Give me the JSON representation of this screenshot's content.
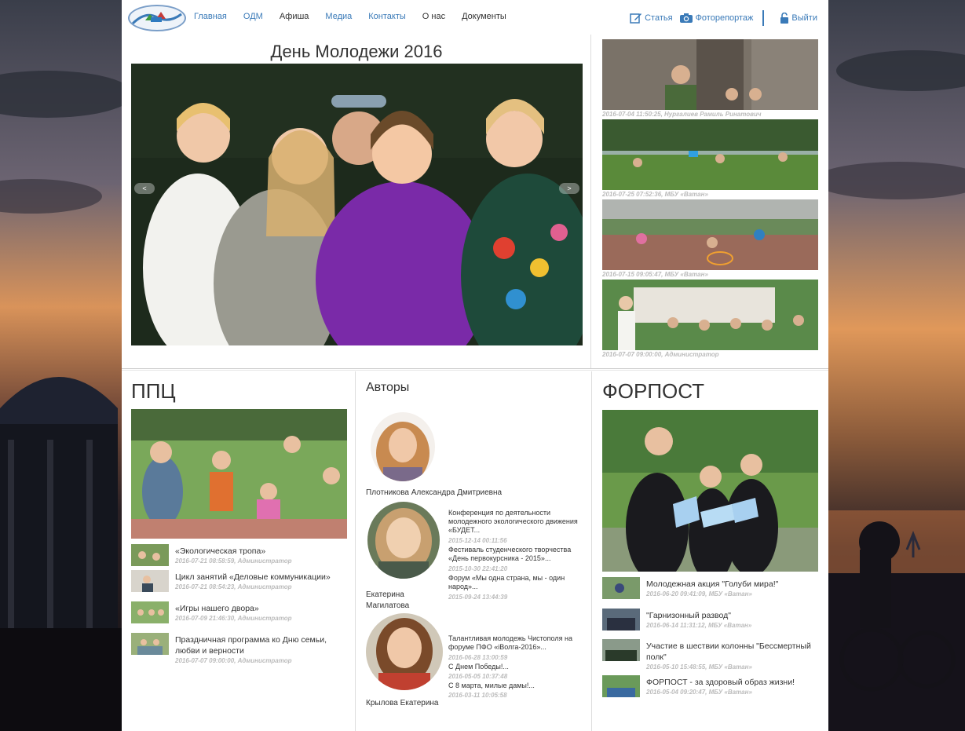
{
  "nav": {
    "items": [
      "Главная",
      "ОДМ",
      "Афиша",
      "Медиа",
      "Контакты",
      "О нас",
      "Документы"
    ],
    "article_label": "Статья",
    "photo_label": "Фоторепортаж",
    "logout_label": "Выйти"
  },
  "slider": {
    "title": "День Молодежи 2016",
    "prev": "<",
    "next": ">"
  },
  "thumbs": [
    {
      "caption": "2016-07-04 11:50:25, Нургалиев Рамиль Ринатович"
    },
    {
      "caption": "2016-07-25 07:52:36, МБУ «Ватан»"
    },
    {
      "caption": "2016-07-15 09:05:47, МБУ «Ватан»"
    },
    {
      "caption": "2016-07-07 09:00:00, Администратор"
    }
  ],
  "ppc": {
    "title": "ППЦ",
    "news": [
      {
        "title": "«Экологическая тропа»",
        "date": "2016-07-21 08:58:59, Администратор"
      },
      {
        "title": "Цикл занятий «Деловые коммуникации»",
        "date": "2016-07-21 08:54:23, Администратор"
      },
      {
        "title": "«Игры нашего двора»",
        "date": "2016-07-09 21:46:30, Администратор"
      },
      {
        "title": "Праздничная программа ко Дню семьи, любви и верности",
        "date": "2016-07-07 09:00:00, Администратор"
      }
    ]
  },
  "authors": {
    "title": "Авторы",
    "a1": {
      "name": "Плотникова Александра Дмитриевна"
    },
    "a2": {
      "name": "Екатерина Магилатова",
      "items": [
        {
          "title": "Конференция по деятельности молодежного экологического движения «БУДЕТ...",
          "date": "2015-12-14 00:11:56"
        },
        {
          "title": "Фестиваль студенческого творчества «День первокурсника - 2015»...",
          "date": "2015-10-30 22:41:20"
        },
        {
          "title": "Форум «Мы одна страна, мы - один народ»...",
          "date": "2015-09-24 13:44:39"
        }
      ]
    },
    "a3": {
      "name": "Крылова Екатерина",
      "items": [
        {
          "title": "Талантливая молодежь Чистополя на форуме ПФО «iВолга-2016»...",
          "date": "2016-06-28 13:00:59"
        },
        {
          "title": "С Днем Победы!...",
          "date": "2016-05-05 10:37:48"
        },
        {
          "title": "С 8 марта, милые дамы!...",
          "date": "2016-03-11 10:05:58"
        }
      ]
    }
  },
  "forpost": {
    "title": "ФОРПОСТ",
    "news": [
      {
        "title": "Молодежная акция \"Голуби мира!\"",
        "date": "2016-06-20 09:41:09, МБУ «Ватан»"
      },
      {
        "title": "\"Гарнизонный развод\"",
        "date": "2016-06-14 11:31:12, МБУ «Ватан»"
      },
      {
        "title": "Участие в шествии колонны \"Бессмертный полк\"",
        "date": "2016-05-10 15:48:55, МБУ «Ватан»"
      },
      {
        "title": "ФОРПОСТ - за здоровый образ жизни!",
        "date": "2016-05-04 09:20:47, МБУ «Ватан»"
      }
    ]
  }
}
